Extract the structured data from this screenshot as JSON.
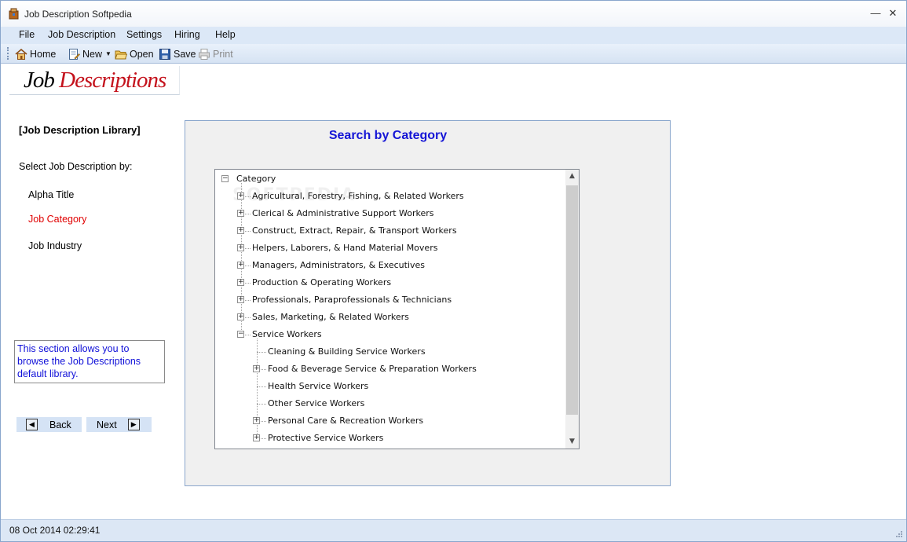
{
  "window": {
    "title": "Job Description Softpedia",
    "minimize_glyph": "—",
    "close_glyph": "✕"
  },
  "menu": [
    "File",
    "Job Description",
    "Settings",
    "Hiring",
    "Help"
  ],
  "toolbar": {
    "home": "Home",
    "new": "New",
    "open": "Open",
    "save": "Save",
    "print": "Print"
  },
  "logo": {
    "word1": "Job",
    "word2": "Descriptions"
  },
  "sidebar": {
    "section_title": "[Job Description Library]",
    "select_label": "Select Job Description by:",
    "links": [
      {
        "label": "Alpha Title",
        "active": false
      },
      {
        "label": "Job Category",
        "active": true
      },
      {
        "label": "Job Industry",
        "active": false
      }
    ],
    "info_text": "This section allows you to browse the Job Descriptions default library.",
    "back_label": "Back",
    "next_label": "Next"
  },
  "panel": {
    "title": "Search by Category"
  },
  "tree": {
    "root": "Category",
    "items": [
      {
        "label": "Agricultural, Forestry, Fishing, & Related Workers",
        "level": 1,
        "toggle": "+"
      },
      {
        "label": "Clerical & Administrative Support Workers",
        "level": 1,
        "toggle": "+"
      },
      {
        "label": "Construct, Extract, Repair, & Transport Workers",
        "level": 1,
        "toggle": "+"
      },
      {
        "label": "Helpers, Laborers, & Hand Material Movers",
        "level": 1,
        "toggle": "+"
      },
      {
        "label": "Managers, Administrators, & Executives",
        "level": 1,
        "toggle": "+"
      },
      {
        "label": "Production & Operating Workers",
        "level": 1,
        "toggle": "+"
      },
      {
        "label": "Professionals, Paraprofessionals & Technicians",
        "level": 1,
        "toggle": "+"
      },
      {
        "label": "Sales, Marketing, & Related Workers",
        "level": 1,
        "toggle": "+"
      },
      {
        "label": "Service Workers",
        "level": 1,
        "toggle": "-"
      },
      {
        "label": "Cleaning & Building Service Workers",
        "level": 2,
        "toggle": ""
      },
      {
        "label": "Food & Beverage Service & Preparation Workers",
        "level": 2,
        "toggle": "+"
      },
      {
        "label": "Health Service Workers",
        "level": 2,
        "toggle": ""
      },
      {
        "label": "Other Service Workers",
        "level": 2,
        "toggle": ""
      },
      {
        "label": "Personal Care & Recreation Workers",
        "level": 2,
        "toggle": "+"
      },
      {
        "label": "Protective Service Workers",
        "level": 2,
        "toggle": "+"
      }
    ]
  },
  "watermark": "SOFTPEDIA",
  "status": {
    "datetime": "08 Oct 2014 02:29:41"
  },
  "colors": {
    "link_active": "#e00000",
    "panel_title": "#1515d6",
    "info_text": "#1010d8",
    "logo_red": "#c4121c"
  }
}
